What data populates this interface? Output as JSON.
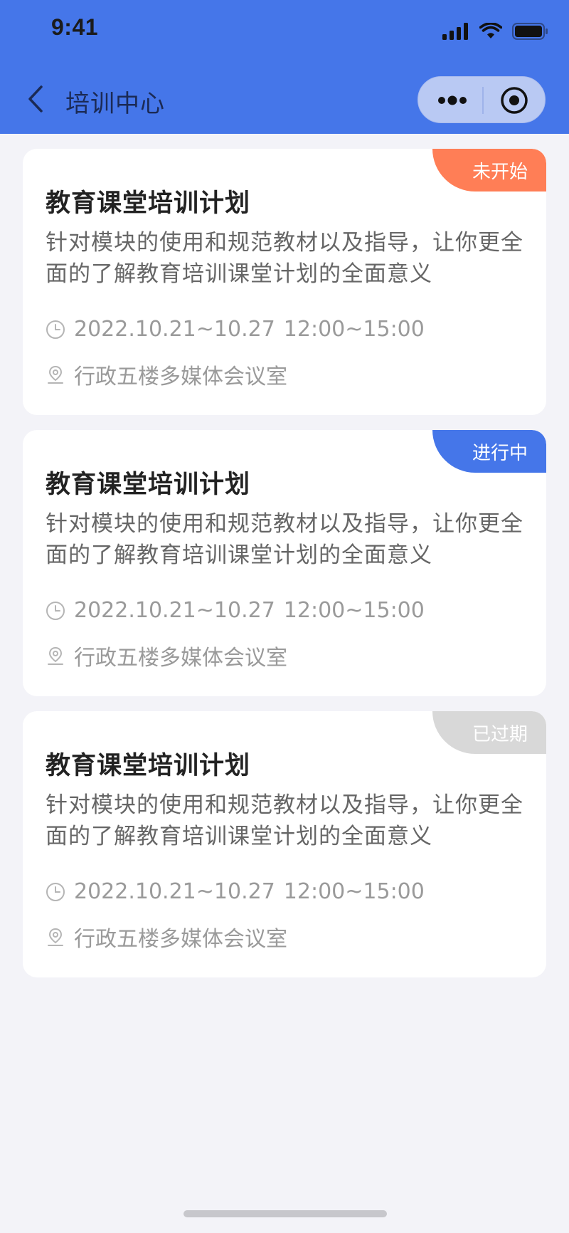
{
  "status_bar": {
    "time": "9:41"
  },
  "nav": {
    "title": "培训中心"
  },
  "colors": {
    "header": "#4576e9",
    "not_started": "#ff7e56",
    "in_progress": "#4576e9",
    "expired": "#d8d8d8"
  },
  "cards": [
    {
      "title": "教育课堂培训计划",
      "description": "针对模块的使用和规范教材以及指导，让你更全面的了解教育培训课堂计划的全面意义",
      "date_range": "2022.10.21~10.27",
      "time_range": "12:00~15:00",
      "location": "行政五楼多媒体会议室",
      "status": "未开始"
    },
    {
      "title": "教育课堂培训计划",
      "description": "针对模块的使用和规范教材以及指导，让你更全面的了解教育培训课堂计划的全面意义",
      "date_range": "2022.10.21~10.27",
      "time_range": "12:00~15:00",
      "location": "行政五楼多媒体会议室",
      "status": "进行中"
    },
    {
      "title": "教育课堂培训计划",
      "description": "针对模块的使用和规范教材以及指导，让你更全面的了解教育培训课堂计划的全面意义",
      "date_range": "2022.10.21~10.27",
      "time_range": "12:00~15:00",
      "location": "行政五楼多媒体会议室",
      "status": "已过期"
    }
  ]
}
